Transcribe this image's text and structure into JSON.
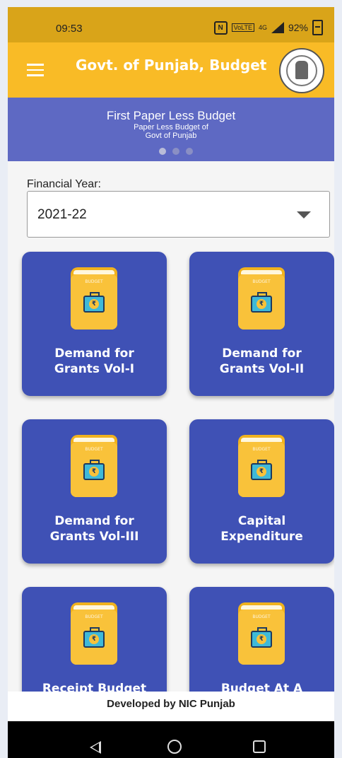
{
  "status_bar": {
    "time": "09:53",
    "nfc_icon": "N",
    "volte_label": "VoLTE",
    "network_label": "4G",
    "battery": "92%"
  },
  "app_bar": {
    "title": "Govt. of Punjab, Budget"
  },
  "banner": {
    "title": "First Paper Less Budget",
    "subtitle_line1": "Paper Less Budget of",
    "subtitle_line2": "Govt of Punjab"
  },
  "financial_year": {
    "label": "Financial Year:",
    "selected": "2021-22"
  },
  "tiles": [
    {
      "label": "Demand for\nGrants Vol-I",
      "book_label": "BUDGET"
    },
    {
      "label": "Demand for\nGrants Vol-II",
      "book_label": "BUDGET"
    },
    {
      "label": "Demand for\nGrants Vol-III",
      "book_label": "BUDGET"
    },
    {
      "label": "Capital\nExpenditure",
      "book_label": "BUDGET"
    },
    {
      "label": "Receipt Budget",
      "book_label": "BUDGET"
    },
    {
      "label": "Budget At A",
      "book_label": "BUDGET"
    }
  ],
  "footer": {
    "text": "Developed by NIC Punjab"
  },
  "colors": {
    "status_bar": "#d9a419",
    "app_bar": "#f9bb26",
    "banner": "#5e69c3",
    "tile": "#3f51b5",
    "book": "#f9c23a"
  }
}
